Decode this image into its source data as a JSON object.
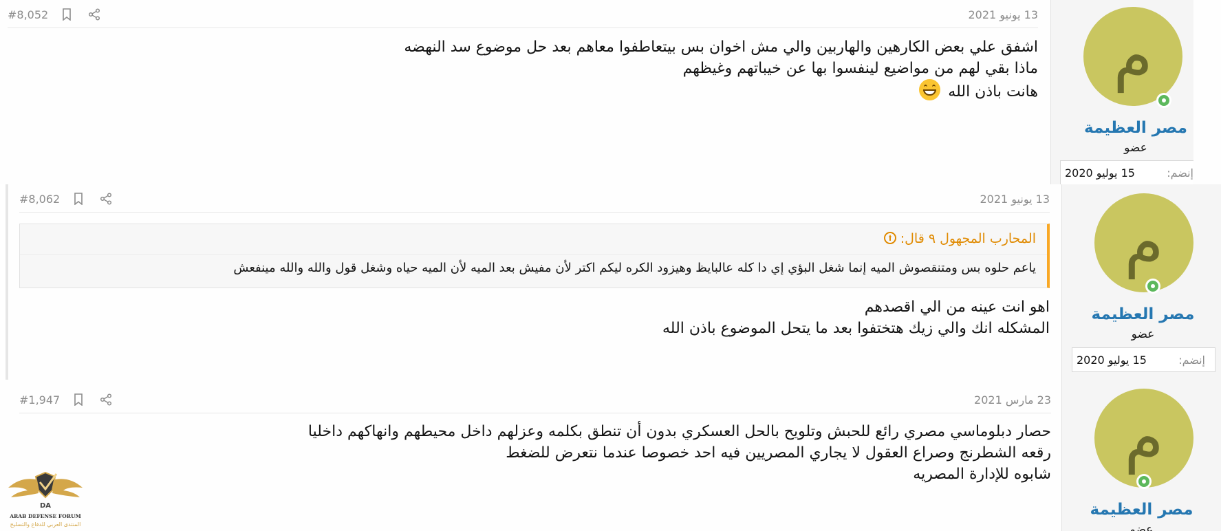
{
  "posts": [
    {
      "date": "13 يونيو 2021",
      "number": "#8,052",
      "author": "مصر العظيمة",
      "avatar_letter": "م",
      "role": "عضو",
      "join_label": "إنضم:",
      "join_date": "15 يوليو 2020",
      "lines": [
        "اشفق علي بعض الكارهين والهاربين والي مش اخوان بس بيتعاطفوا معاهم بعد حل موضوع سد النهضه",
        "ماذا بقي لهم من مواضيع لينفسوا بها عن خيباتهم وغيظهم",
        "هانت باذن الله"
      ],
      "emoji": "grinning-face-icon"
    },
    {
      "date": "13 يونيو 2021",
      "number": "#8,062",
      "author": "مصر العظيمة",
      "avatar_letter": "م",
      "role": "عضو",
      "join_label": "إنضم:",
      "join_date": "15 يوليو 2020",
      "quote": {
        "attribution": "المحارب المجهول ٩ قال:",
        "text": "ياعم حلوه بس ومتنقصوش الميه إنما شغل البؤي إي دا كله عالبايظ وهيزود الكره ليكم اكتر لأن مفيش بعد الميه لأن الميه حياه وشغل قول والله والله مينفعش"
      },
      "lines": [
        "اهو انت عينه من الي اقصدهم",
        "المشكله انك والي زيك هتختفوا بعد ما يتحل الموضوع باذن الله"
      ]
    },
    {
      "date": "23 مارس 2021",
      "number": "#1,947",
      "author": "مصر العظيمة",
      "avatar_letter": "م",
      "role": "عضو",
      "lines": [
        "حصار دبلوماسي مصري رائع للحبش وتلويح بالحل العسكري بدون أن تنطق بكلمه وعزلهم داخل محيطهم وانهاكهم داخليا",
        "رقعه الشطرنج وصراع العقول لا يجاري المصريين فيه احد خصوصا عندما نتعرض للضغط",
        "شابوه للإدارة المصريه"
      ]
    }
  ],
  "logo": {
    "title": "ARAB DEFENSE FORUM",
    "subtitle": "المنتدى العربي للدفاع والتسليح",
    "monogram": "DA"
  },
  "colors": {
    "accent": "#2577b1",
    "quote_accent": "#f9a825",
    "avatar": "#c9c660",
    "online": "#5cb85c"
  }
}
